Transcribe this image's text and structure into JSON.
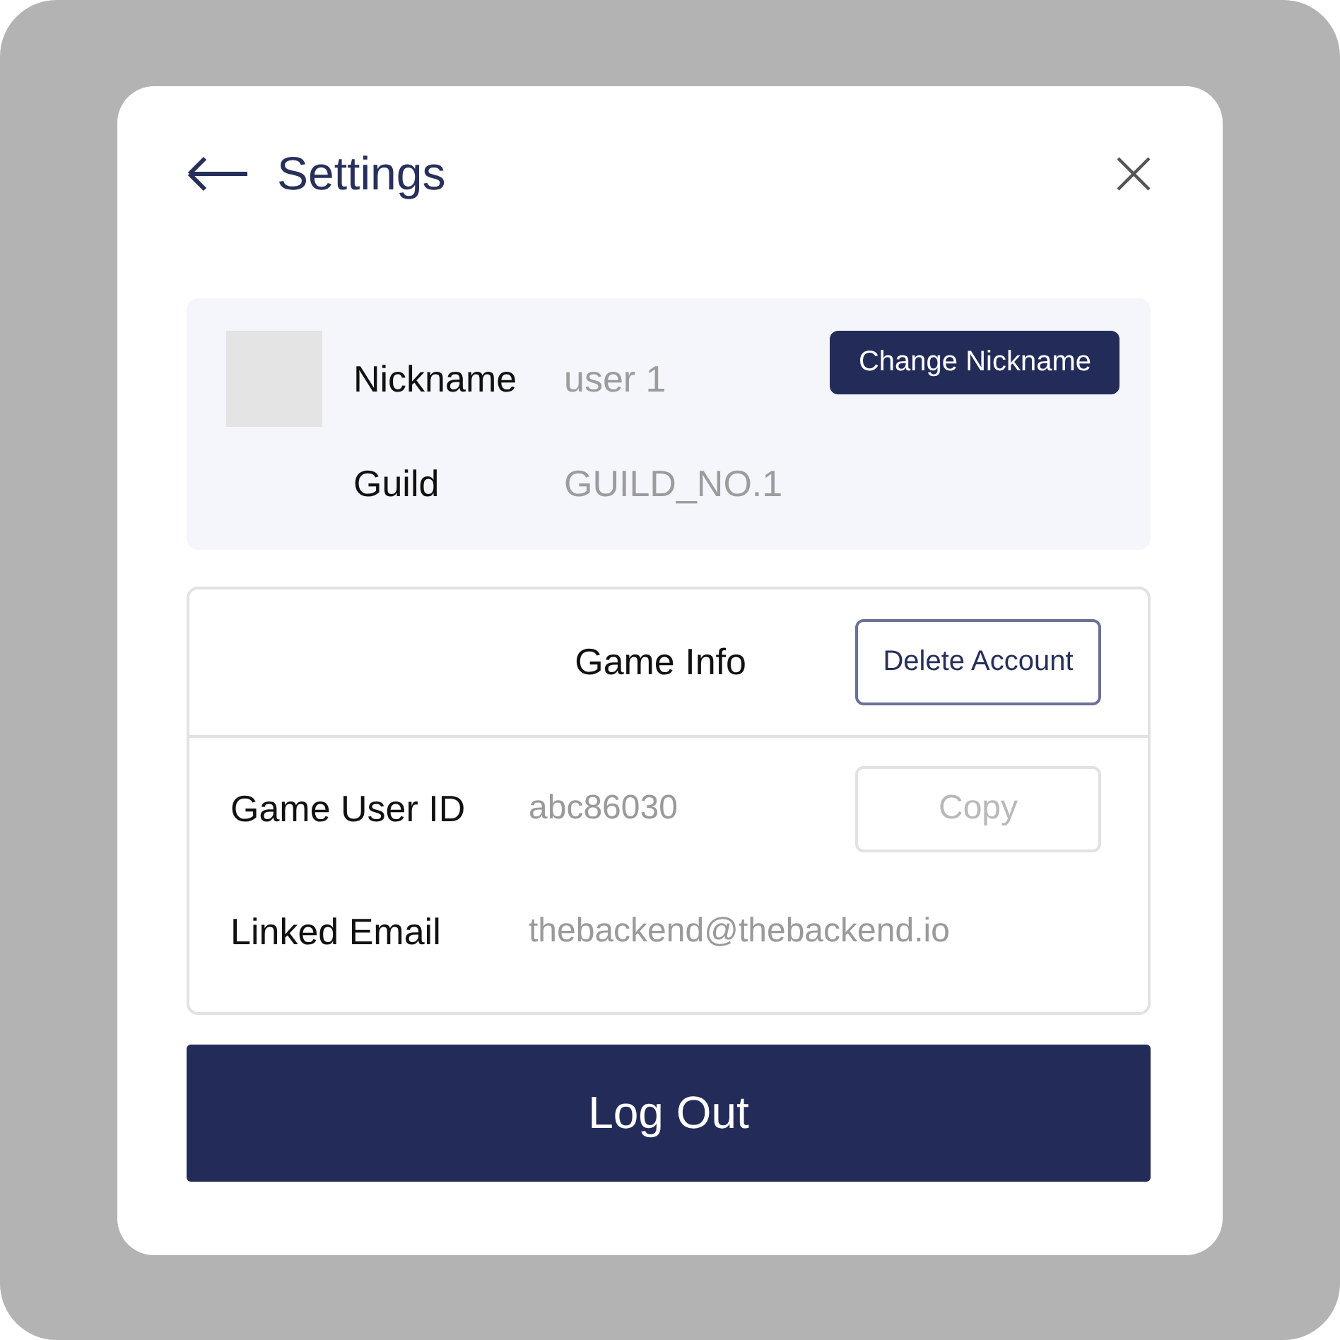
{
  "header": {
    "title": "Settings"
  },
  "profile": {
    "rows": [
      {
        "label": "Nickname",
        "value": "user 1"
      },
      {
        "label": "Guild",
        "value": "GUILD_NO.1"
      }
    ],
    "button": "Change Nickname"
  },
  "game_info": {
    "title": "Game Info",
    "button": "Delete Account",
    "rows": [
      {
        "label": "Game User ID",
        "value": "abc86030",
        "button": {
          "label": "Copy",
          "disabled": true
        }
      },
      {
        "label": "Linked Email",
        "value": "thebackend@thebackend.io"
      }
    ]
  },
  "logout": "Log Out"
}
